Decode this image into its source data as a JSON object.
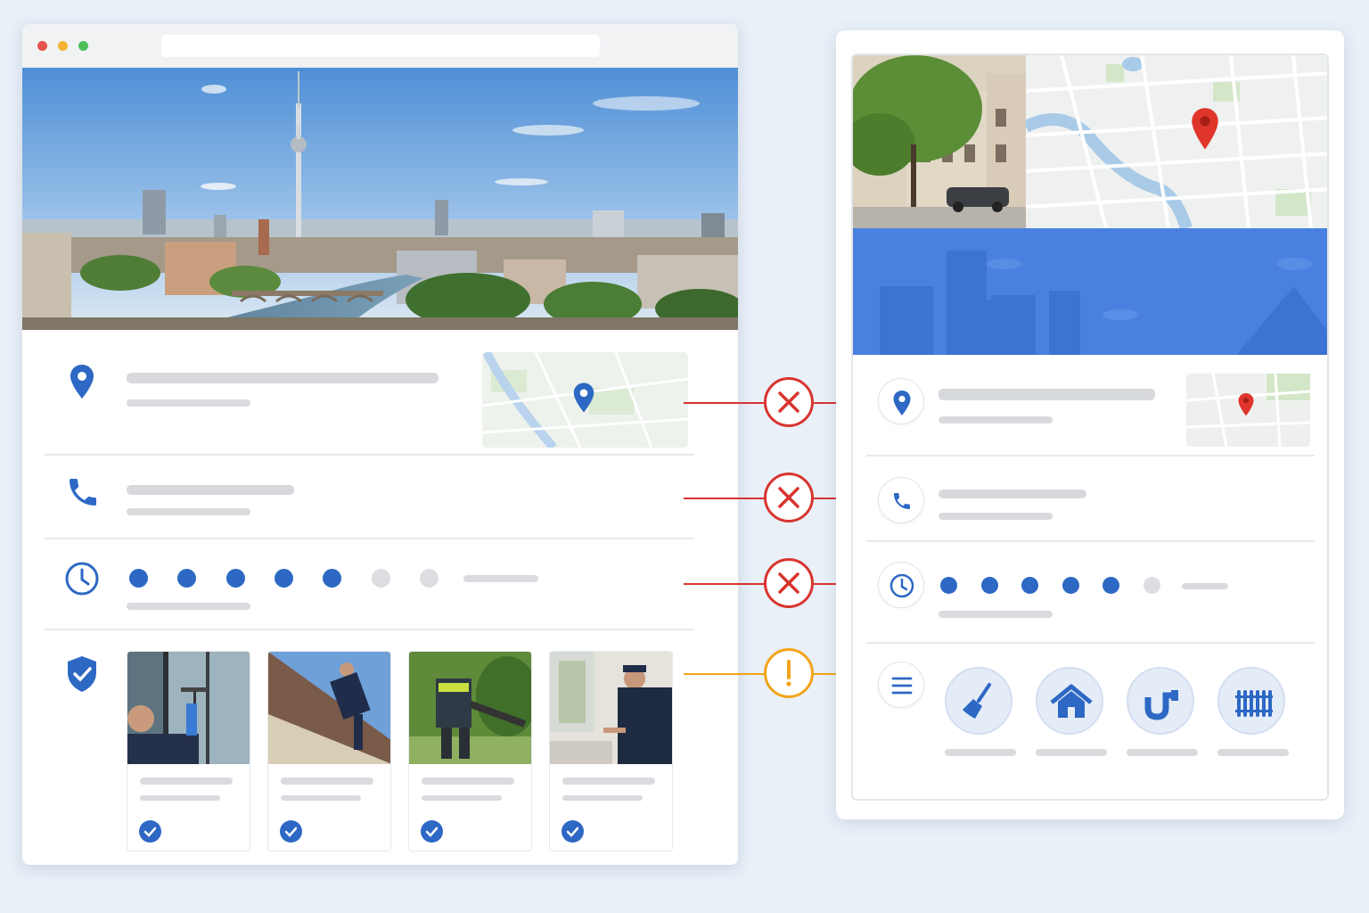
{
  "left_window": {
    "traffic_lights": [
      "#e5534b",
      "#f2b335",
      "#4cbf5a"
    ],
    "hero_image": "berlin-skyline-photo",
    "rows": [
      {
        "icon": "location-pin-icon",
        "has_map": true
      },
      {
        "icon": "phone-icon"
      },
      {
        "icon": "clock-icon",
        "rating_filled": 5,
        "rating_total": 7
      },
      {
        "icon": "shield-check-icon"
      }
    ],
    "service_cards": [
      {
        "image": "window-cleaner-photo"
      },
      {
        "image": "roofer-photo"
      },
      {
        "image": "gardener-leaf-blower-photo"
      },
      {
        "image": "window-repair-photo"
      }
    ]
  },
  "right_window": {
    "banner_color": "#4a80e0",
    "rows": [
      {
        "icon": "location-pin-icon",
        "has_map": true
      },
      {
        "icon": "phone-icon"
      },
      {
        "icon": "clock-icon",
        "rating_filled": 5,
        "rating_total": 6
      },
      {
        "icon": "menu-icon"
      }
    ],
    "service_icons": [
      "broom-icon",
      "house-icon",
      "pipe-icon",
      "radiator-icon"
    ]
  },
  "comparisons": [
    {
      "status": "mismatch",
      "symbol": "✕",
      "color": "#d8342e"
    },
    {
      "status": "mismatch",
      "symbol": "✕",
      "color": "#d8342e"
    },
    {
      "status": "mismatch",
      "symbol": "✕",
      "color": "#d8342e"
    },
    {
      "status": "warning",
      "symbol": "!",
      "color": "#f2a41a"
    }
  ],
  "colors": {
    "accent_blue": "#2d68c4",
    "map_pin_red": "#e0352b",
    "background": "#e9f0f8"
  }
}
